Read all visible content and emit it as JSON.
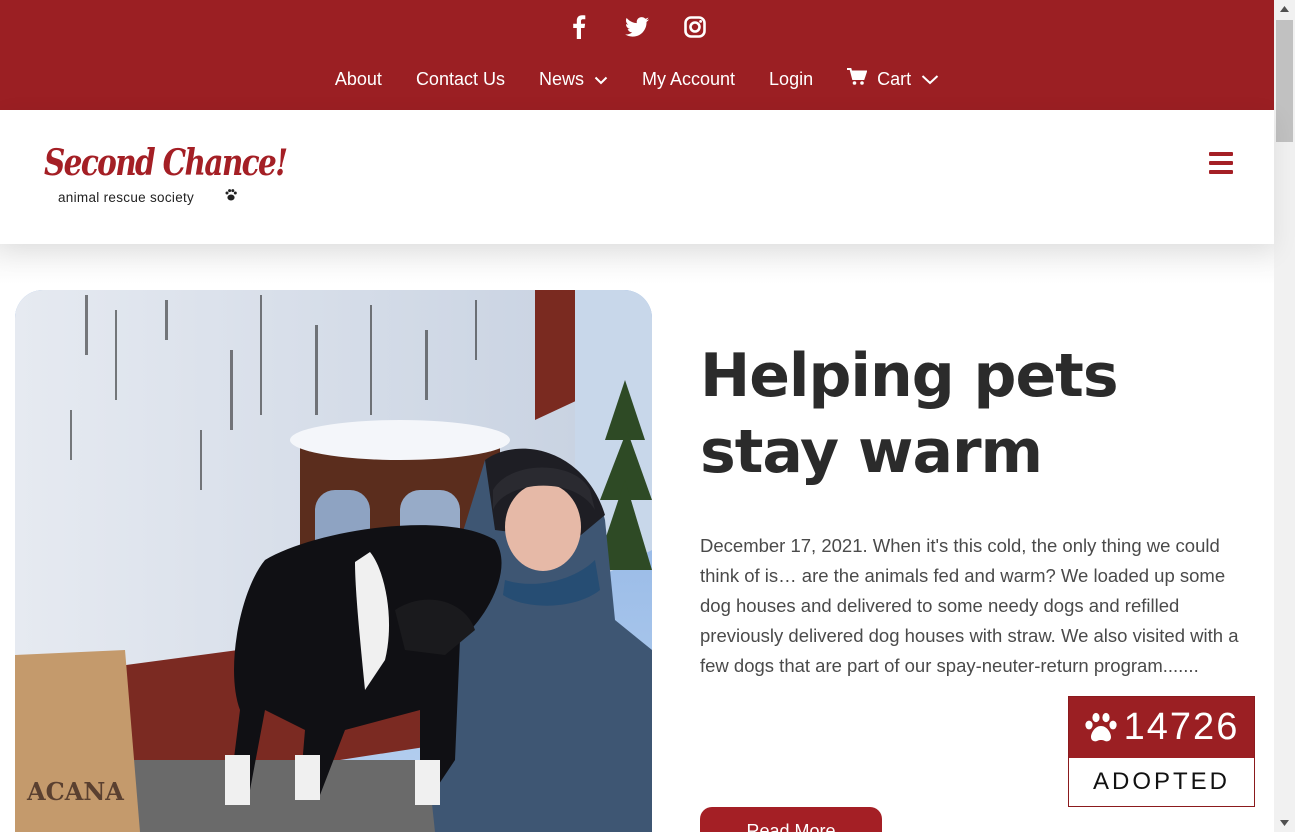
{
  "social": {
    "icons": [
      "facebook-icon",
      "twitter-icon",
      "instagram-icon"
    ]
  },
  "nav": {
    "items": [
      {
        "label": "About"
      },
      {
        "label": "Contact Us"
      },
      {
        "label": "News",
        "has_dropdown": true
      },
      {
        "label": "My Account"
      },
      {
        "label": "Login"
      },
      {
        "label": "Cart",
        "icon": "cart-icon",
        "has_dropdown": true
      }
    ]
  },
  "logo": {
    "title": "Second Chance!",
    "subtitle": "animal rescue society"
  },
  "post": {
    "title": "Helping pets stay warm",
    "excerpt": "December 17, 2021. When it's this cold, the only thing we could think of is… are the animals fed and warm? We loaded up some dog houses and delivered to some needy dogs and refilled previously delivered dog houses with straw. We also visited with a few dogs that are part of our spay-neuter-return program.......",
    "button_label": "Read More"
  },
  "counter": {
    "count": "14726",
    "label": "ADOPTED",
    "icon": "paw-icon"
  },
  "colors": {
    "brand": "#9b1f23",
    "heading": "#2b2b2b",
    "body_text": "#4a4a4a"
  }
}
